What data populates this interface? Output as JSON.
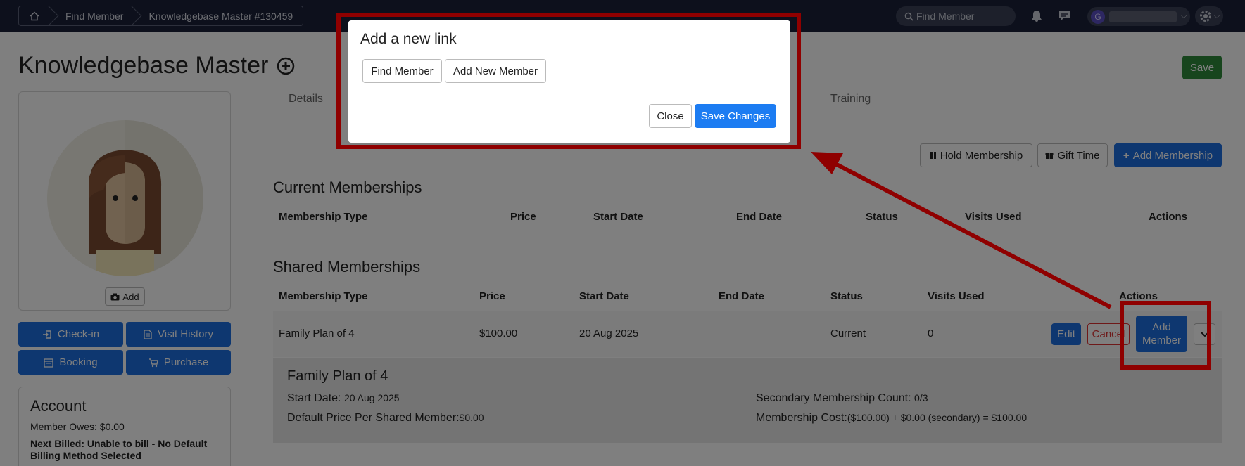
{
  "topbar": {
    "breadcrumbs": [
      "Find Member",
      "Knowledgebase Master #130459"
    ],
    "search_placeholder": "Find Member",
    "user_initial": "G"
  },
  "page": {
    "title": "Knowledgebase Master",
    "save_label": "Save"
  },
  "profile": {
    "add_photo_label": "Add"
  },
  "sidebar": {
    "buttons": [
      "Check-in",
      "Visit History",
      "Booking",
      "Purchase"
    ]
  },
  "account": {
    "title": "Account",
    "owes": "Member Owes: $0.00",
    "next_billed": "Next Billed: Unable to bill - No Default Billing Method Selected"
  },
  "tabs": [
    "Details",
    "Training"
  ],
  "actions": {
    "hold": "Hold Membership",
    "gift": "Gift Time",
    "add": "Add Membership"
  },
  "current_memberships": {
    "title": "Current Memberships",
    "headers": [
      "Membership Type",
      "Price",
      "Start Date",
      "End Date",
      "Status",
      "Visits Used",
      "Actions"
    ]
  },
  "shared_memberships": {
    "title": "Shared Memberships",
    "headers": [
      "Membership Type",
      "Price",
      "Start Date",
      "End Date",
      "Status",
      "Visits Used",
      "Actions"
    ],
    "row": {
      "type": "Family Plan of 4",
      "price": "$100.00",
      "start": "20 Aug 2025",
      "end": "",
      "status": "Current",
      "visits": "0",
      "edit": "Edit",
      "cancel": "Cancel",
      "add_member": "Add Member"
    },
    "detail": {
      "title": "Family Plan of 4",
      "start_label": "Start Date:",
      "start_value": "20 Aug 2025",
      "default_price_label": "Default Price Per Shared Member:",
      "default_price_value": "$0.00",
      "secondary_label": "Secondary Membership Count:",
      "secondary_value": "0/3",
      "cost_label": "Membership Cost:",
      "cost_value": "($100.00) + $0.00 (secondary) = $100.00"
    }
  },
  "modal": {
    "title": "Add a new link",
    "find_member": "Find Member",
    "add_new_member": "Add New Member",
    "close": "Close",
    "save_changes": "Save Changes"
  },
  "colors": {
    "topbar": "#1b2138",
    "primary": "#1c6fe0",
    "success": "#2e8b3a",
    "annotation": "#8f0000"
  }
}
